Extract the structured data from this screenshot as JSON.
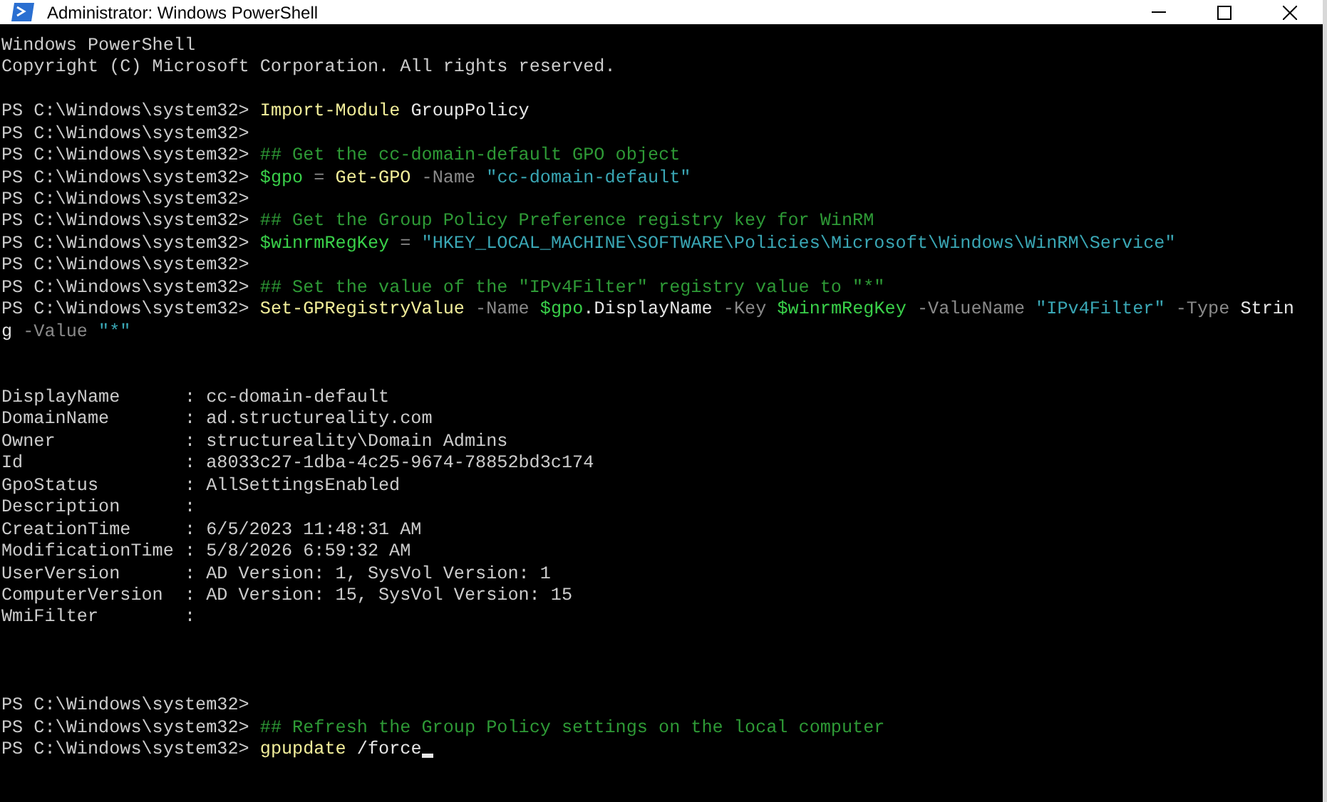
{
  "window": {
    "title": "Administrator: Windows PowerShell"
  },
  "console": [
    {
      "kind": "banner",
      "lines": [
        "Windows PowerShell",
        "Copyright (C) Microsoft Corporation. All rights reserved."
      ]
    },
    {
      "kind": "commands",
      "lines": [
        {
          "prompt": "PS C:\\Windows\\system32>",
          "tokens": [
            {
              "kind": "command",
              "text": "Import-Module"
            },
            {
              "kind": "text",
              "text": "GroupPolicy"
            }
          ]
        },
        {
          "prompt": "PS C:\\Windows\\system32>"
        },
        {
          "prompt": "PS C:\\Windows\\system32>",
          "tokens": [
            {
              "kind": "comment",
              "text": "## Get the cc-domain-default GPO object"
            }
          ]
        },
        {
          "prompt": "PS C:\\Windows\\system32>",
          "tokens": [
            {
              "kind": "variable",
              "text": "$gpo"
            },
            {
              "kind": "operator",
              "text": "="
            },
            {
              "kind": "command",
              "text": "Get-GPO"
            },
            {
              "kind": "parameter",
              "text": "-Name"
            },
            {
              "kind": "string",
              "text": "\"cc-domain-default\""
            }
          ]
        },
        {
          "prompt": "PS C:\\Windows\\system32>"
        },
        {
          "prompt": "PS C:\\Windows\\system32>",
          "tokens": [
            {
              "kind": "comment",
              "text": "## Get the Group Policy Preference registry key for WinRM"
            }
          ]
        },
        {
          "prompt": "PS C:\\Windows\\system32>",
          "tokens": [
            {
              "kind": "variable",
              "text": "$winrmRegKey"
            },
            {
              "kind": "operator",
              "text": "="
            },
            {
              "kind": "string",
              "text": "\"HKEY_LOCAL_MACHINE\\SOFTWARE\\Policies\\Microsoft\\Windows\\WinRM\\Service\""
            }
          ]
        },
        {
          "prompt": "PS C:\\Windows\\system32>"
        },
        {
          "prompt": "PS C:\\Windows\\system32>",
          "tokens": [
            {
              "kind": "comment",
              "text": "## Set the value of the \"IPv4Filter\" registry value to \"*\""
            }
          ]
        },
        {
          "prompt": "PS C:\\Windows\\system32>",
          "tokens": [
            {
              "kind": "command",
              "text": "Set-GPRegistryValue"
            },
            {
              "kind": "parameter",
              "text": "-Name"
            },
            {
              "kind": "variable",
              "text": "$gpo"
            },
            {
              "kind": "member",
              "text": ".DisplayName"
            },
            {
              "kind": "parameter",
              "text": "-Key"
            },
            {
              "kind": "variable",
              "text": "$winrmRegKey"
            },
            {
              "kind": "parameter",
              "text": "-ValueName"
            },
            {
              "kind": "string",
              "text": "\"IPv4Filter\""
            },
            {
              "kind": "parameter",
              "text": "-Type"
            },
            {
              "kind": "text",
              "text": "Strin"
            }
          ]
        },
        {
          "tokens": [
            {
              "kind": "text",
              "text": "g"
            },
            {
              "kind": "parameter",
              "text": "-Value"
            },
            {
              "kind": "string",
              "text": "\"*\""
            }
          ]
        }
      ]
    },
    {
      "kind": "output",
      "separator": ":",
      "rows": [
        {
          "name": "DisplayName",
          "value": "cc-domain-default"
        },
        {
          "name": "DomainName",
          "value": "ad.structureality.com"
        },
        {
          "name": "Owner",
          "value": "structureality\\Domain Admins"
        },
        {
          "name": "Id",
          "value": "a8033c27-1dba-4c25-9674-78852bd3c174"
        },
        {
          "name": "GpoStatus",
          "value": "AllSettingsEnabled"
        },
        {
          "name": "Description"
        },
        {
          "name": "CreationTime",
          "value": "6/5/2023 11:48:31 AM"
        },
        {
          "name": "ModificationTime",
          "value": "5/8/2026 6:59:32 AM"
        },
        {
          "name": "UserVersion",
          "value": "AD Version: 1, SysVol Version: 1"
        },
        {
          "name": "ComputerVersion",
          "value": "AD Version: 15, SysVol Version: 15"
        },
        {
          "name": "WmiFilter"
        }
      ]
    },
    {
      "kind": "commands",
      "lines": [
        {
          "prompt": "PS C:\\Windows\\system32>"
        },
        {
          "prompt": "PS C:\\Windows\\system32>",
          "tokens": [
            {
              "kind": "comment",
              "text": "## Refresh the Group Policy settings on the local computer"
            }
          ]
        },
        {
          "prompt": "PS C:\\Windows\\system32>",
          "tokens": [
            {
              "kind": "command",
              "text": "gpupdate"
            },
            {
              "kind": "text",
              "text": "/force"
            }
          ],
          "cursor": true
        }
      ]
    }
  ]
}
